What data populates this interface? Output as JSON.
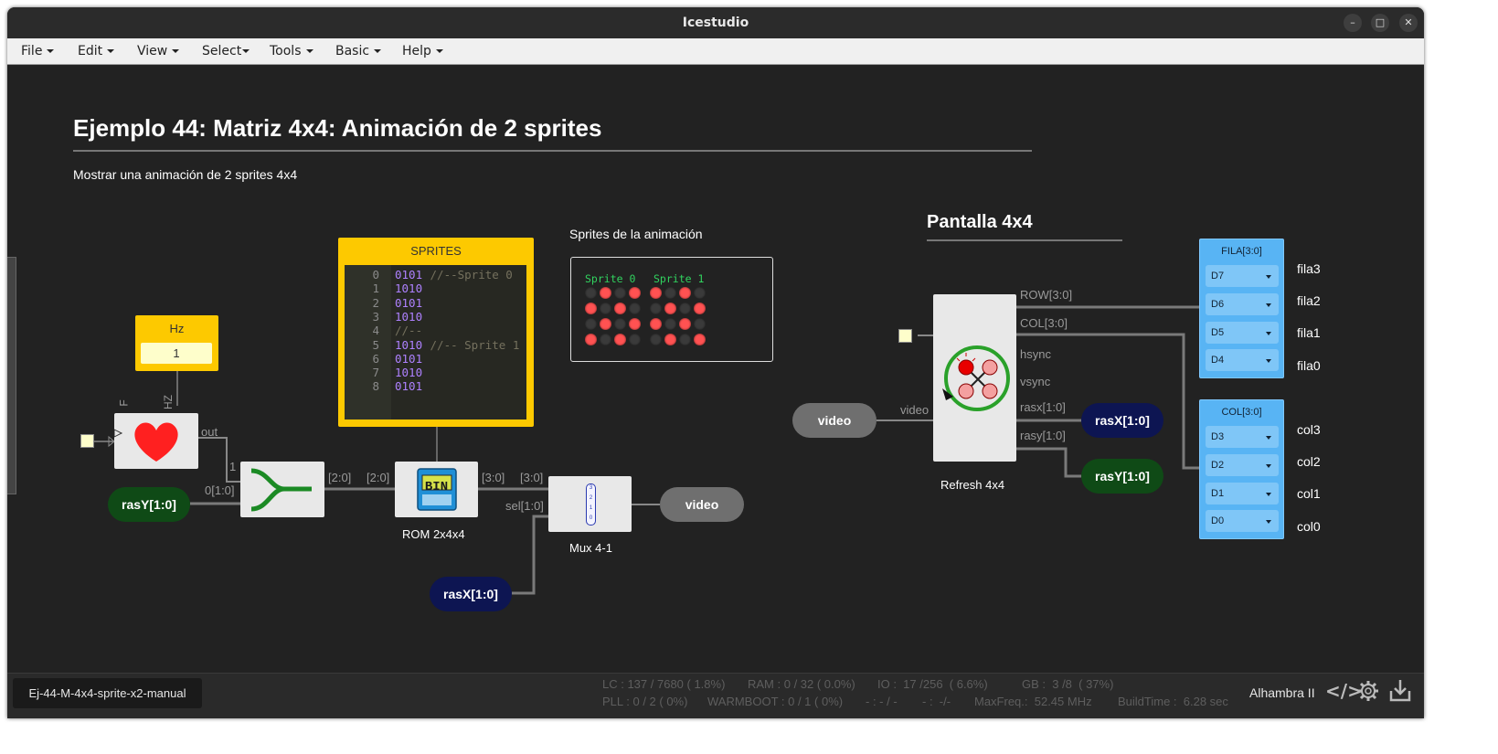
{
  "window": {
    "title": "Icestudio"
  },
  "menu": [
    "File",
    "Edit",
    "View",
    "Select",
    "Tools",
    "Basic",
    "Help"
  ],
  "doc": {
    "title": "Ejemplo 44: Matriz 4x4: Animación de 2 sprites",
    "subtitle": "Mostrar una animación de 2 sprites 4x4",
    "sprites_label": "Sprites de la animación",
    "pantalla_title": "Pantalla 4x4"
  },
  "sprites_preview": {
    "sprite0_label": "Sprite 0",
    "sprite1_label": "Sprite 1",
    "sprite0": [
      "0101",
      "1010",
      "0101",
      "1010"
    ],
    "sprite1": [
      "1010",
      "0101",
      "1010",
      "0101"
    ]
  },
  "rom_memory": {
    "title": "SPRITES",
    "lines": [
      {
        "n": "0",
        "v": "0101",
        "c": " //--Sprite 0"
      },
      {
        "n": "1",
        "v": "1010",
        "c": ""
      },
      {
        "n": "2",
        "v": "0101",
        "c": ""
      },
      {
        "n": "3",
        "v": "1010",
        "c": ""
      },
      {
        "n": "4",
        "v": "",
        "c": "//--"
      },
      {
        "n": "5",
        "v": "1010",
        "c": " //-- Sprite 1"
      },
      {
        "n": "6",
        "v": "0101",
        "c": ""
      },
      {
        "n": "7",
        "v": "1010",
        "c": ""
      },
      {
        "n": "8",
        "v": "0101",
        "c": ""
      }
    ]
  },
  "hz_const": {
    "title": "Hz",
    "value": "1"
  },
  "prescaler": {
    "label_f": "F",
    "label_hz": "HZ",
    "out": "out"
  },
  "ports": {
    "one": "1",
    "zero_rasy": "0[1:0]",
    "join_out": "[2:0]",
    "rom_in": "[2:0]",
    "rom_out": "[3:0]",
    "mux_in": "[3:0]",
    "mux_sel": "sel[1:0]",
    "video_in": "video",
    "row": "ROW[3:0]",
    "col": "COL[3:0]",
    "hsync": "hsync",
    "vsync": "vsync",
    "rasx": "rasx[1:0]",
    "rasy": "rasy[1:0]"
  },
  "blocks": {
    "rom_label": "ROM 2x4x4",
    "rom_icon": "BIN",
    "mux_label": "Mux 4-1",
    "refresh_label": "Refresh 4x4"
  },
  "mux_icon_digits": [
    "3",
    "2",
    "1",
    "0"
  ],
  "pills": {
    "rasy_in": "rasY[1:0]",
    "rasx_in": "rasX[1:0]",
    "video_out": "video",
    "video_in": "video",
    "rasx_out": "rasX[1:0]",
    "rasy_out": "rasY[1:0]"
  },
  "fila_group": {
    "title": "FILA[3:0]",
    "pins": [
      {
        "pin": "D7",
        "name": "fila3"
      },
      {
        "pin": "D6",
        "name": "fila2"
      },
      {
        "pin": "D5",
        "name": "fila1"
      },
      {
        "pin": "D4",
        "name": "fila0"
      }
    ]
  },
  "col_group": {
    "title": "COL[3:0]",
    "pins": [
      {
        "pin": "D3",
        "name": "col3"
      },
      {
        "pin": "D2",
        "name": "col2"
      },
      {
        "pin": "D1",
        "name": "col1"
      },
      {
        "pin": "D0",
        "name": "col0"
      }
    ]
  },
  "status": {
    "project": "Ej-44-M-4x4-sprite-x2-manual",
    "lc": "LC : 137 / 7680 ( 1.8%)",
    "ram": "RAM : 0 / 32 ( 0.0%)",
    "io": "IO :  17 /256  ( 6.6%)",
    "gb": "GB :  3 /8  ( 37%)",
    "pll": "PLL : 0 / 2 ( 0%)",
    "warmboot": "WARMBOOT : 0 / 1 ( 0%)",
    "dash1": "- : - / -",
    "dash2": "- :  -/-",
    "maxfreq": "MaxFreq.:  52.45 MHz",
    "buildtime": "BuildTime :  6.28 sec",
    "board": "Alhambra II"
  },
  "colors": {
    "block_fill": "#e8e8e8",
    "wire": "#777777",
    "pin_blue": "#58b4f4",
    "memory_yellow": "#fdc900",
    "led_red": "#ff5252",
    "pill_green": "#0f4a16",
    "pill_navy": "#0d1552",
    "pill_grey": "#6f6f6f"
  },
  "icons": [
    "heart-icon",
    "join-bus-icon",
    "bin-file-icon",
    "mux-icon",
    "led-matrix-refresh-icon",
    "code-icon",
    "gear-icon",
    "download-icon"
  ]
}
